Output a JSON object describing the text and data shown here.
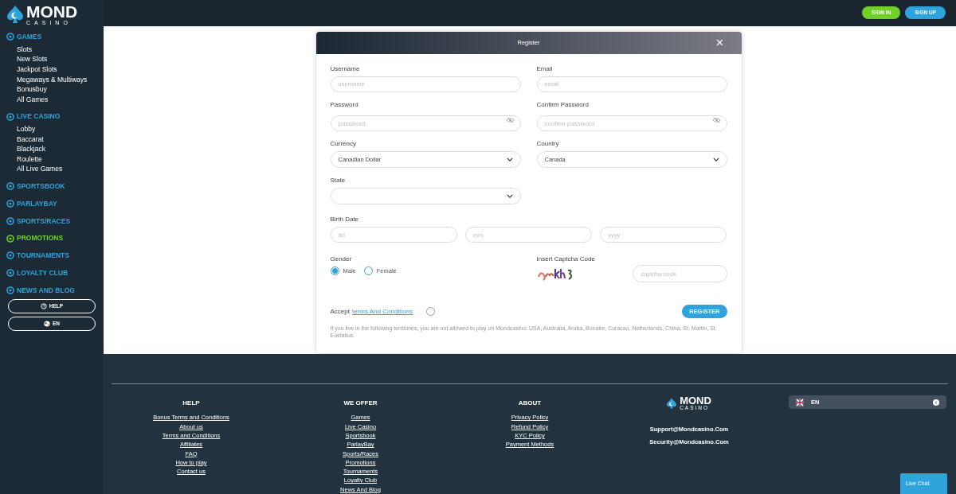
{
  "brand": {
    "name": "MOND",
    "sub": "CASINO"
  },
  "header": {
    "buttons": [
      {
        "label": "SIGN IN",
        "kind": "signin"
      },
      {
        "label": "SIGN UP",
        "kind": "signup"
      }
    ]
  },
  "sidebar": {
    "sections": [
      {
        "label": "GAMES",
        "color": "#2ea3dc",
        "children": [
          {
            "label": "Slots"
          },
          {
            "label": "New Slots"
          },
          {
            "label": "Jackpot Slots"
          },
          {
            "label": "Megaways & Multiways"
          },
          {
            "label": "Bonusbuy"
          },
          {
            "label": "All Games"
          }
        ]
      },
      {
        "label": "LIVE CASINO",
        "color": "#2ea3dc",
        "children": [
          {
            "label": "Lobby"
          },
          {
            "label": "Baccarat"
          },
          {
            "label": "Blackjack"
          },
          {
            "label": "Roulette"
          },
          {
            "label": "All Live Games"
          }
        ]
      },
      {
        "label": "SPORTSBOOK",
        "color": "#2ea3dc"
      },
      {
        "label": "PARLAYBAY",
        "color": "#2ea3dc"
      },
      {
        "label": "SPORTS/RACES",
        "color": "#2ea3dc"
      },
      {
        "label": "PROMOTIONS",
        "color": "#6fd12a"
      },
      {
        "label": "TOURNAMENTS",
        "color": "#2ea3dc"
      },
      {
        "label": "LOYALTY CLUB",
        "color": "#2ea3dc"
      },
      {
        "label": "NEWS AND BLOG",
        "color": "#2ea3dc"
      }
    ],
    "buttons": [
      {
        "label": "HELP",
        "kind": "help"
      },
      {
        "label": "EN",
        "kind": "lang"
      }
    ]
  },
  "modal": {
    "title": "Register",
    "close": "×",
    "rows": [
      [
        {
          "label": "Username",
          "kind": "text",
          "placeholder": "username"
        },
        {
          "label": "Email",
          "kind": "text",
          "placeholder": "email"
        }
      ],
      [
        {
          "label": "Password",
          "kind": "password",
          "placeholder": "password"
        },
        {
          "label": "Confirm Password",
          "kind": "password",
          "placeholder": "confirm password"
        }
      ],
      [
        {
          "label": "Currency",
          "kind": "select",
          "value": "Canadian Dollar"
        },
        {
          "label": "Country",
          "kind": "select",
          "value": "Canada"
        }
      ],
      [
        {
          "label": "State",
          "kind": "select"
        }
      ]
    ],
    "birth_date": {
      "label": "Birth Date",
      "placeholders": [
        "dd",
        "mm",
        "yyyy"
      ]
    },
    "gender": {
      "label": "Gender",
      "options": [
        {
          "label": "Male",
          "selected": true
        },
        {
          "label": "Female",
          "selected": false
        }
      ]
    },
    "captcha": {
      "label": "Insert Captcha Code",
      "placeholder": "captcha code"
    },
    "terms": {
      "prefix": "Accept",
      "link": "terms And Conditions",
      "checked": false
    },
    "submit": "REGISTER",
    "notice": "If you live in the following territories, you are not allowed to play on Mondcasino: USA, Australia, Aruba, Bonaire, Curacao, Netherlands, China, St. Martin, St. Eustatius."
  },
  "footer": {
    "columns": [
      {
        "title": "HELP",
        "links": [
          "Bonus Terms and Conditions",
          "About us",
          "Terms and Conditions",
          "Affiliates",
          "FAQ",
          "How to play",
          "Contact us"
        ]
      },
      {
        "title": "WE OFFER",
        "links": [
          "Games",
          "Live Casino",
          "Sportsbook",
          "ParlayBay",
          "Sports/Races",
          "Promotions",
          "Tournaments",
          "Loyalty Club",
          "News And Blog"
        ]
      },
      {
        "title": "ABOUT",
        "links": [
          "Privacy Policy",
          "Refund Policy",
          "KYC Policy",
          "Payment Methods"
        ]
      }
    ],
    "brand": {
      "name": "MOND",
      "sub": "CASINO"
    },
    "emails": [
      "Support@Mondcasino.Com",
      "Security@Mondcasino.Com"
    ],
    "language": "EN"
  },
  "live_chat": "Live Chat"
}
